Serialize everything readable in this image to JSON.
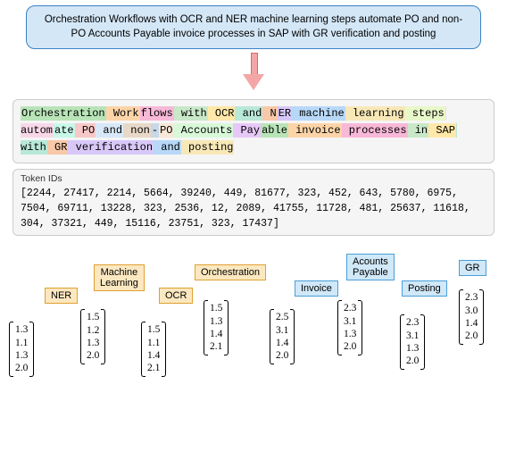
{
  "header": "Orchestration Workflows with OCR and NER machine learning steps automate PO and non-PO Accounts Payable invoice processes in SAP with GR verification and posting",
  "tokens": [
    "Orchestration",
    " Work",
    "flows",
    " with",
    " OCR",
    " and",
    " N",
    "ER",
    " machine",
    " learning",
    " steps",
    " autom",
    "ate",
    " PO",
    " and",
    " non",
    "-",
    "PO",
    " Accounts",
    " Pay",
    "able",
    " invoice",
    " processes",
    " in",
    " SAP",
    " with",
    " GR",
    " verification",
    " and",
    " posting"
  ],
  "token_ids_title": "Token IDs",
  "token_ids": "[2244, 27417, 2214, 5664, 39240, 449, 81677, 323, 452, 643, 5780, 6975, 7504, 69711, 13228, 323, 2536, 12, 2089, 41755, 11728, 481, 25637, 11618, 304, 37321, 449, 15116, 23751, 323, 17437]",
  "labels": {
    "ner": "NER",
    "ml": "Machine\nLearning",
    "ocr": "OCR",
    "orch": "Orchestration",
    "inv": "Invoice",
    "ap": "Acounts\nPayable",
    "post": "Posting",
    "gr": "GR"
  },
  "vectors": {
    "v1": [
      "1.3",
      "1.1",
      "1.3",
      "2.0"
    ],
    "v2": [
      "1.5",
      "1.2",
      "1.3",
      "2.0"
    ],
    "v3": [
      "1.5",
      "1.1",
      "1.4",
      "2.1"
    ],
    "v4": [
      "1.5",
      "1.3",
      "1.4",
      "2.1"
    ],
    "v5": [
      "2.5",
      "3.1",
      "1.4",
      "2.0"
    ],
    "v6": [
      "2.3",
      "3.1",
      "1.3",
      "2.0"
    ],
    "v7": [
      "2.3",
      "3.1",
      "1.3",
      "2.0"
    ],
    "v8": [
      "2.3",
      "3.0",
      "1.4",
      "2.0"
    ]
  }
}
